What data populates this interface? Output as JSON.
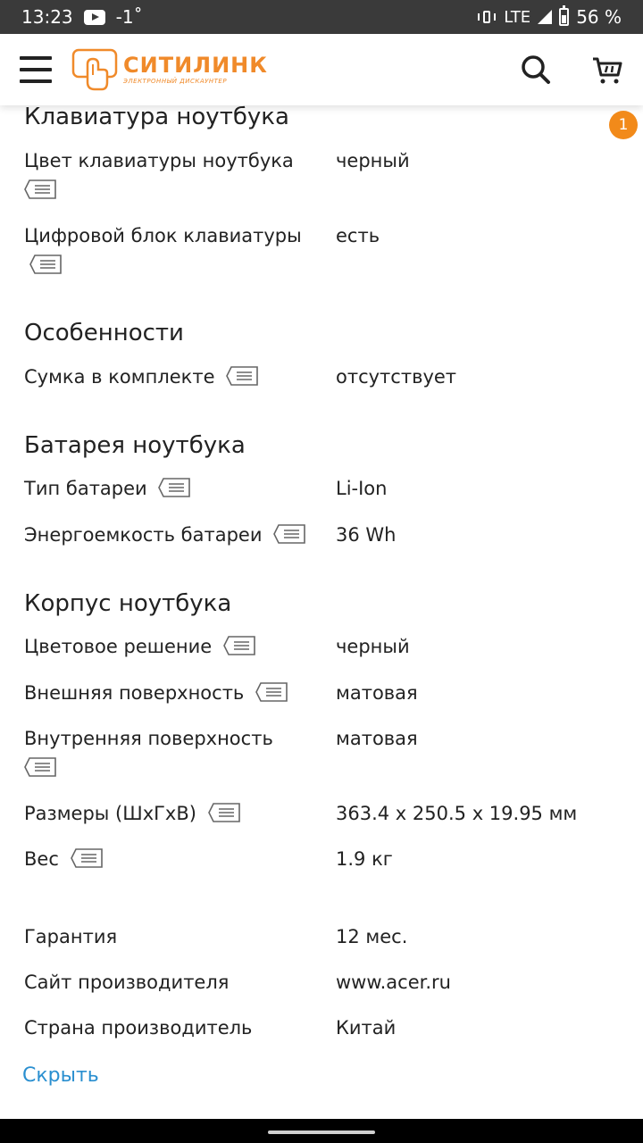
{
  "status_bar": {
    "time": "13:23",
    "temperature": "-1˚",
    "network": "LTE",
    "battery_percent": "56 %",
    "icons": [
      "youtube-icon",
      "vibrate-icon",
      "signal-icon",
      "battery-icon"
    ]
  },
  "header": {
    "logo_name": "СИТИЛИНК",
    "logo_subtitle": "ЭЛЕКТРОННЫЙ ДИСКАУНТЕР",
    "icons": [
      "menu-icon",
      "search-icon",
      "cart-icon"
    ],
    "badge_count": "1",
    "brand_color": "#f08a2a"
  },
  "sections": [
    {
      "title": "Клавиатура ноутбука",
      "rows": [
        {
          "label": "Цвет клавиатуры ноутбука",
          "value": "черный"
        },
        {
          "label": "Цифровой блок клавиатуры",
          "value": "есть"
        }
      ]
    },
    {
      "title": "Особенности",
      "rows": [
        {
          "label": "Сумка в комплекте",
          "value": "отсутствует"
        }
      ]
    },
    {
      "title": "Батарея ноутбука",
      "rows": [
        {
          "label": "Тип батареи",
          "value": "Li-Ion"
        },
        {
          "label": "Энергоемкость батареи",
          "value": "36 Wh"
        }
      ]
    },
    {
      "title": "Корпус ноутбука",
      "rows": [
        {
          "label": "Цветовое решение",
          "value": "черный"
        },
        {
          "label": "Внешняя поверхность",
          "value": "матовая"
        },
        {
          "label": "Внутренняя поверхность",
          "value": "матовая"
        },
        {
          "label": "Размеры (ШхГхВ)",
          "value": "363.4 x 250.5 x 19.95 мм"
        },
        {
          "label": "Вес",
          "value": "1.9 кг"
        }
      ]
    }
  ],
  "extra_rows": [
    {
      "label": "Гарантия",
      "value": "12 мес."
    },
    {
      "label": "Сайт производителя",
      "value": "www.acer.ru"
    },
    {
      "label": "Страна производитель",
      "value": "Китай"
    }
  ],
  "hide_link": "Скрыть",
  "link_color": "#2a8fd0"
}
